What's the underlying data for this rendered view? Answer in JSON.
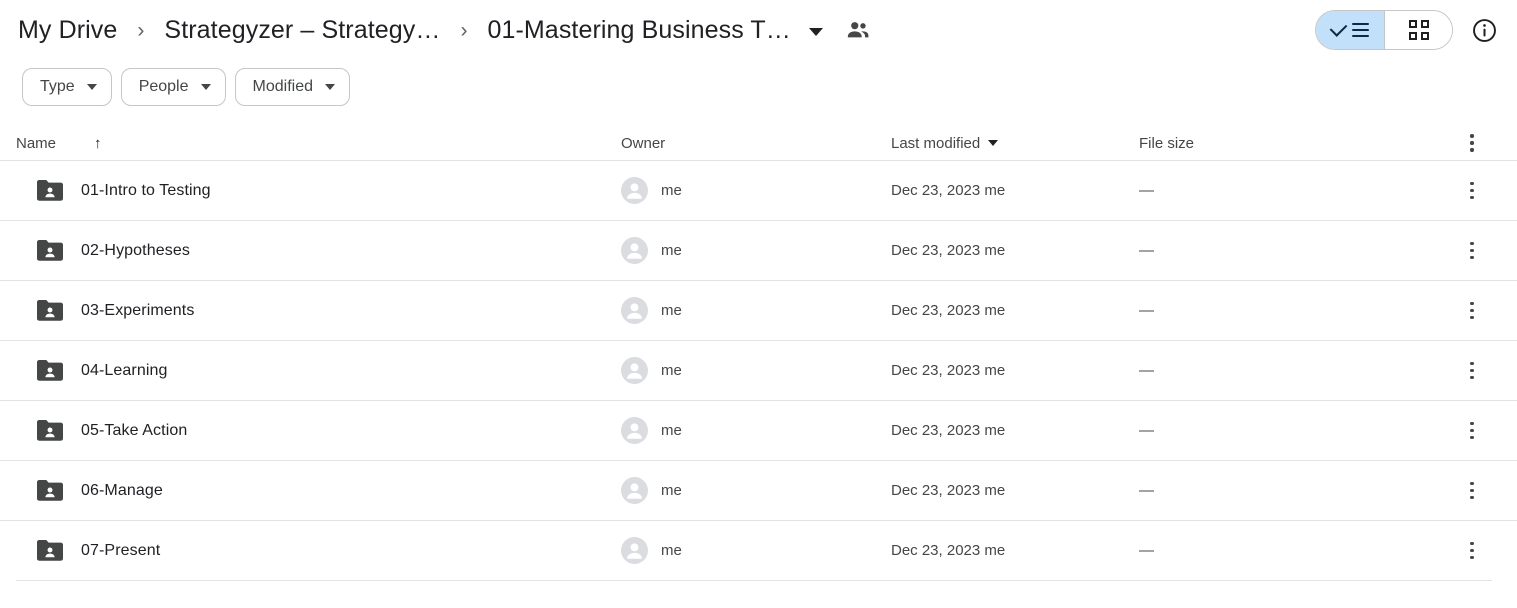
{
  "breadcrumb": {
    "items": [
      {
        "label": "My Drive"
      },
      {
        "label": "Strategyzer – Strategy…"
      },
      {
        "label": "01-Mastering Business T…"
      }
    ],
    "separator": "›",
    "dropdown_icon": "caret-down-icon",
    "people_icon": "people-shared-icon"
  },
  "view_toggle": {
    "list": {
      "label": "List view",
      "icon": "list-view-icon",
      "selected": true
    },
    "grid": {
      "label": "Grid view",
      "icon": "grid-view-icon",
      "selected": false
    },
    "active_background": "#c2e0f9",
    "active_foreground": "#0b2948"
  },
  "info_button": {
    "label": "View details",
    "icon": "info-circle-icon"
  },
  "filters": [
    {
      "label": "Type",
      "icon": "caret-down-icon"
    },
    {
      "label": "People",
      "icon": "caret-down-icon"
    },
    {
      "label": "Modified",
      "icon": "caret-down-icon"
    }
  ],
  "table": {
    "columns": {
      "name": "Name",
      "owner": "Owner",
      "modified": "Last modified",
      "size": "File size"
    },
    "sort": {
      "column": "Name",
      "direction": "ascending",
      "arrow_glyph": "↑",
      "modified_caret": "caret-down-icon"
    },
    "header_menu_icon": "more-vertical-icon",
    "rows": [
      {
        "name": "01-Intro to Testing",
        "icon": "shared-folder-icon",
        "owner": "me",
        "modified": "Dec 23, 2023 me",
        "size": "—",
        "menu_icon": "more-vertical-icon"
      },
      {
        "name": "02-Hypotheses",
        "icon": "shared-folder-icon",
        "owner": "me",
        "modified": "Dec 23, 2023 me",
        "size": "—",
        "menu_icon": "more-vertical-icon"
      },
      {
        "name": "03-Experiments",
        "icon": "shared-folder-icon",
        "owner": "me",
        "modified": "Dec 23, 2023 me",
        "size": "—",
        "menu_icon": "more-vertical-icon"
      },
      {
        "name": "04-Learning",
        "icon": "shared-folder-icon",
        "owner": "me",
        "modified": "Dec 23, 2023 me",
        "size": "—",
        "menu_icon": "more-vertical-icon"
      },
      {
        "name": "05-Take Action",
        "icon": "shared-folder-icon",
        "owner": "me",
        "modified": "Dec 23, 2023 me",
        "size": "—",
        "menu_icon": "more-vertical-icon"
      },
      {
        "name": "06-Manage",
        "icon": "shared-folder-icon",
        "owner": "me",
        "modified": "Dec 23, 2023 me",
        "size": "—",
        "menu_icon": "more-vertical-icon"
      },
      {
        "name": "07-Present",
        "icon": "shared-folder-icon",
        "owner": "me",
        "modified": "Dec 23, 2023 me",
        "size": "—",
        "menu_icon": "more-vertical-icon"
      }
    ]
  }
}
